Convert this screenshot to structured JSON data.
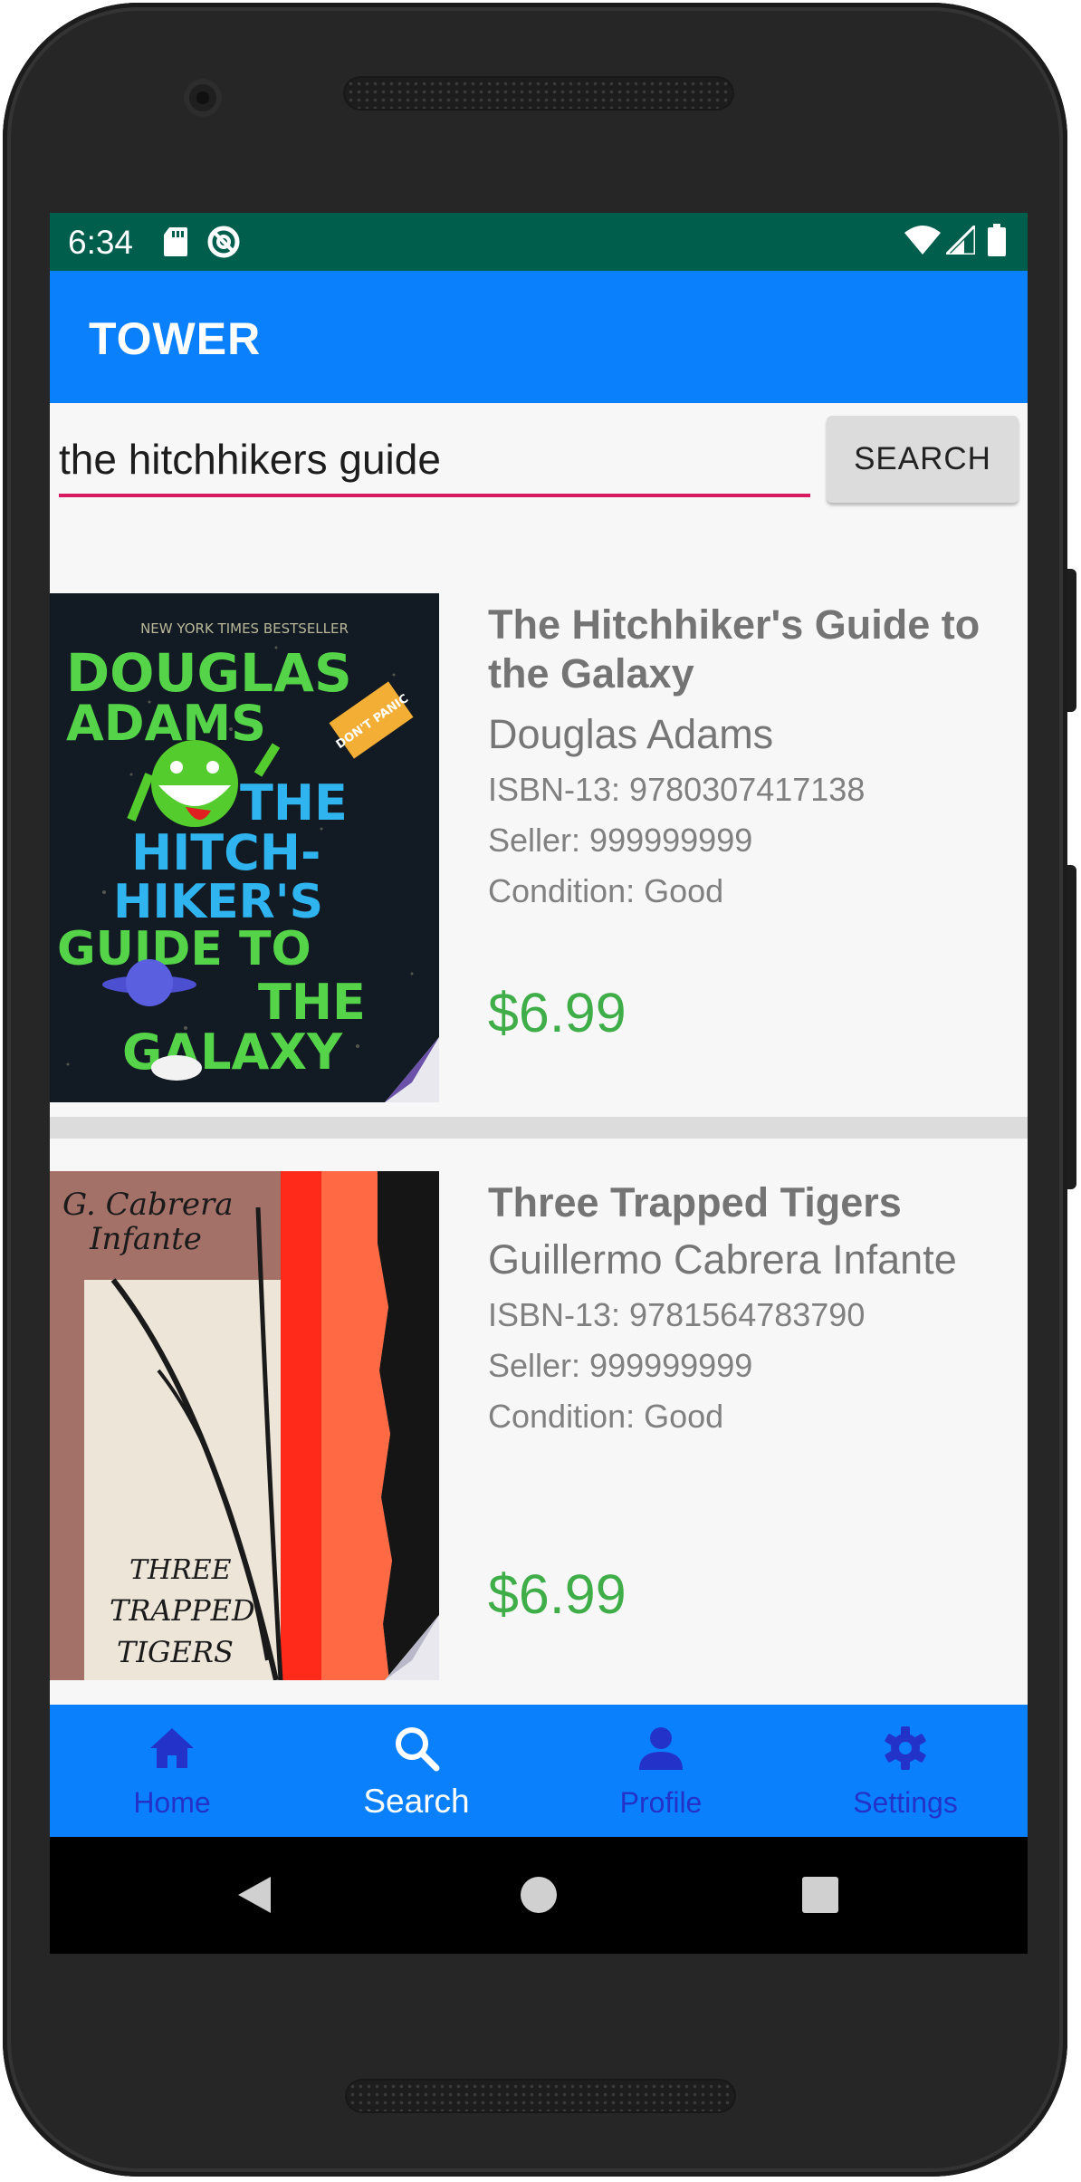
{
  "status_bar": {
    "time": "6:34",
    "icons": [
      "sd-card-icon",
      "sync-disabled-icon",
      "wifi-icon",
      "signal-icon",
      "battery-icon"
    ]
  },
  "app_bar": {
    "title": "TOWER"
  },
  "search": {
    "query": "the hitchhikers guide",
    "button_label": "SEARCH"
  },
  "results": [
    {
      "title": "The Hitchhiker's Guide to the Galaxy",
      "author": "Douglas Adams",
      "isbn": "ISBN-13: 9780307417138",
      "seller": "Seller: 999999999",
      "condition": "Condition: Good",
      "price": "$6.99",
      "cover_text": {
        "tagline": "NEW YORK TIMES BESTSELLER",
        "author_line1": "DOUGLAS",
        "author_line2": "ADAMS",
        "badge": "DON'T PANIC",
        "t1": "THE",
        "t2": "HITCH-",
        "t3": "HIKER'S",
        "t4": "GUIDE TO",
        "t5": "THE",
        "t6": "GALAXY"
      }
    },
    {
      "title": "Three Trapped Tigers",
      "author": "Guillermo Cabrera Infante",
      "isbn": "ISBN-13: 9781564783790",
      "seller": "Seller: 999999999",
      "condition": "Condition: Good",
      "price": "$6.99",
      "cover_text": {
        "author_line1": "G. Cabrera",
        "author_line2": "Infante",
        "t1": "THREE",
        "t2": "TRAPPED",
        "t3": "TIGERS"
      }
    }
  ],
  "bottom_nav": {
    "items": [
      {
        "label": "Home",
        "icon": "home-icon",
        "active": false
      },
      {
        "label": "Search",
        "icon": "search-icon",
        "active": true
      },
      {
        "label": "Profile",
        "icon": "person-icon",
        "active": false
      },
      {
        "label": "Settings",
        "icon": "gear-icon",
        "active": false
      }
    ]
  },
  "system_nav": [
    "back-icon",
    "home-circle-icon",
    "recents-icon"
  ],
  "colors": {
    "status_bar": "#005e4d",
    "app_bar": "#0a80fc",
    "search_underline": "#d81b60",
    "price": "#3fae49",
    "nav_inactive": "#2333c9",
    "nav_active": "#ffffff"
  }
}
